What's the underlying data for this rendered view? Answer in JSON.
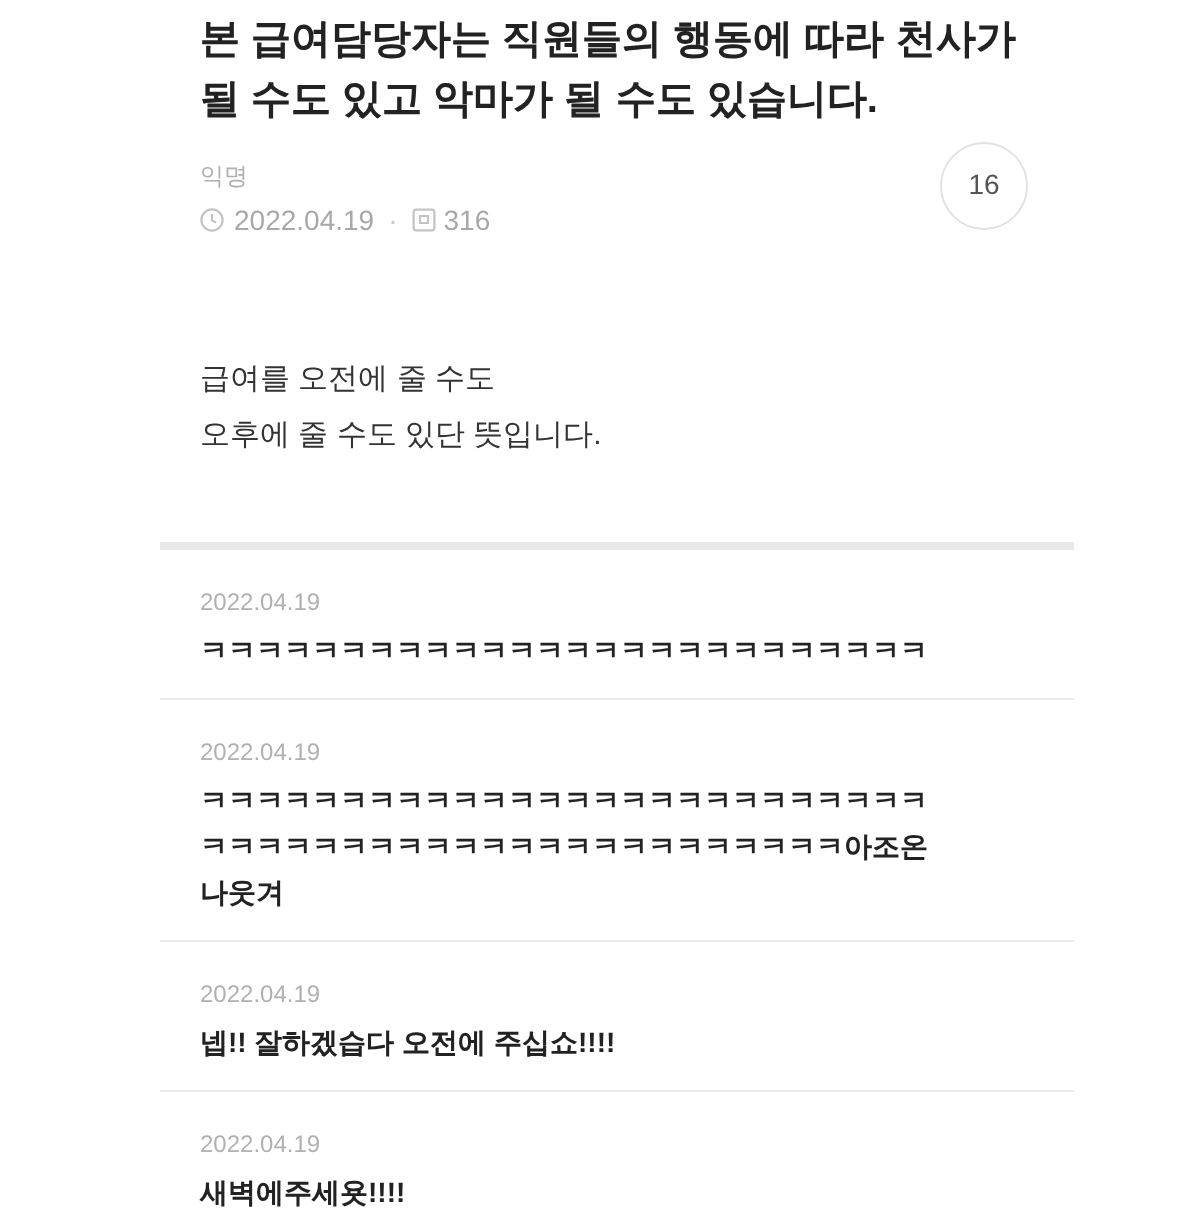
{
  "post": {
    "title": "본 급여담당자는 직원들의 행동에 따라 천사가 될 수도 있고 악마가 될 수도 있습니다.",
    "author": "익명",
    "date": "2022.04.19",
    "separator": "·",
    "views": "316",
    "comment_count": "16",
    "body": "급여를 오전에 줄 수도\n오후에 줄 수도 있단 뜻입니다."
  },
  "comments": [
    {
      "date": "2022.04.19",
      "text": "ㅋㅋㅋㅋㅋㅋㅋㅋㅋㅋㅋㅋㅋㅋㅋㅋㅋㅋㅋㅋㅋㅋㅋㅋㅋㅋ"
    },
    {
      "date": "2022.04.19",
      "text": "ㅋㅋㅋㅋㅋㅋㅋㅋㅋㅋㅋㅋㅋㅋㅋㅋㅋㅋㅋㅋㅋㅋㅋㅋㅋㅋㅋㅋㅋㅋㅋㅋㅋㅋㅋㅋㅋㅋㅋㅋㅋㅋㅋㅋㅋㅋㅋㅋㅋ아조온나웃겨"
    },
    {
      "date": "2022.04.19",
      "text": "넵!! 잘하겠습다 오전에 주십쇼!!!!"
    },
    {
      "date": "2022.04.19",
      "text": "새벽에주세욧!!!!"
    }
  ]
}
